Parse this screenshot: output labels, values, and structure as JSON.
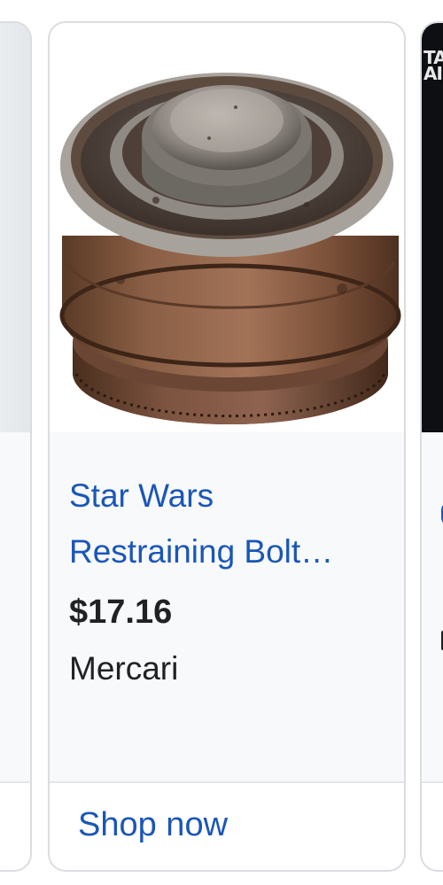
{
  "carousel": {
    "main_card": {
      "title": "Star Wars Restraining Bolt…",
      "price": "$17.16",
      "merchant": "Mercari",
      "action_label": "Shop now"
    },
    "right_card": {
      "image_text": "TA\nAI"
    }
  },
  "colors": {
    "link": "#1a56b8",
    "text": "#202124",
    "info_background": "#f8f9fa",
    "border": "#dadce0"
  }
}
